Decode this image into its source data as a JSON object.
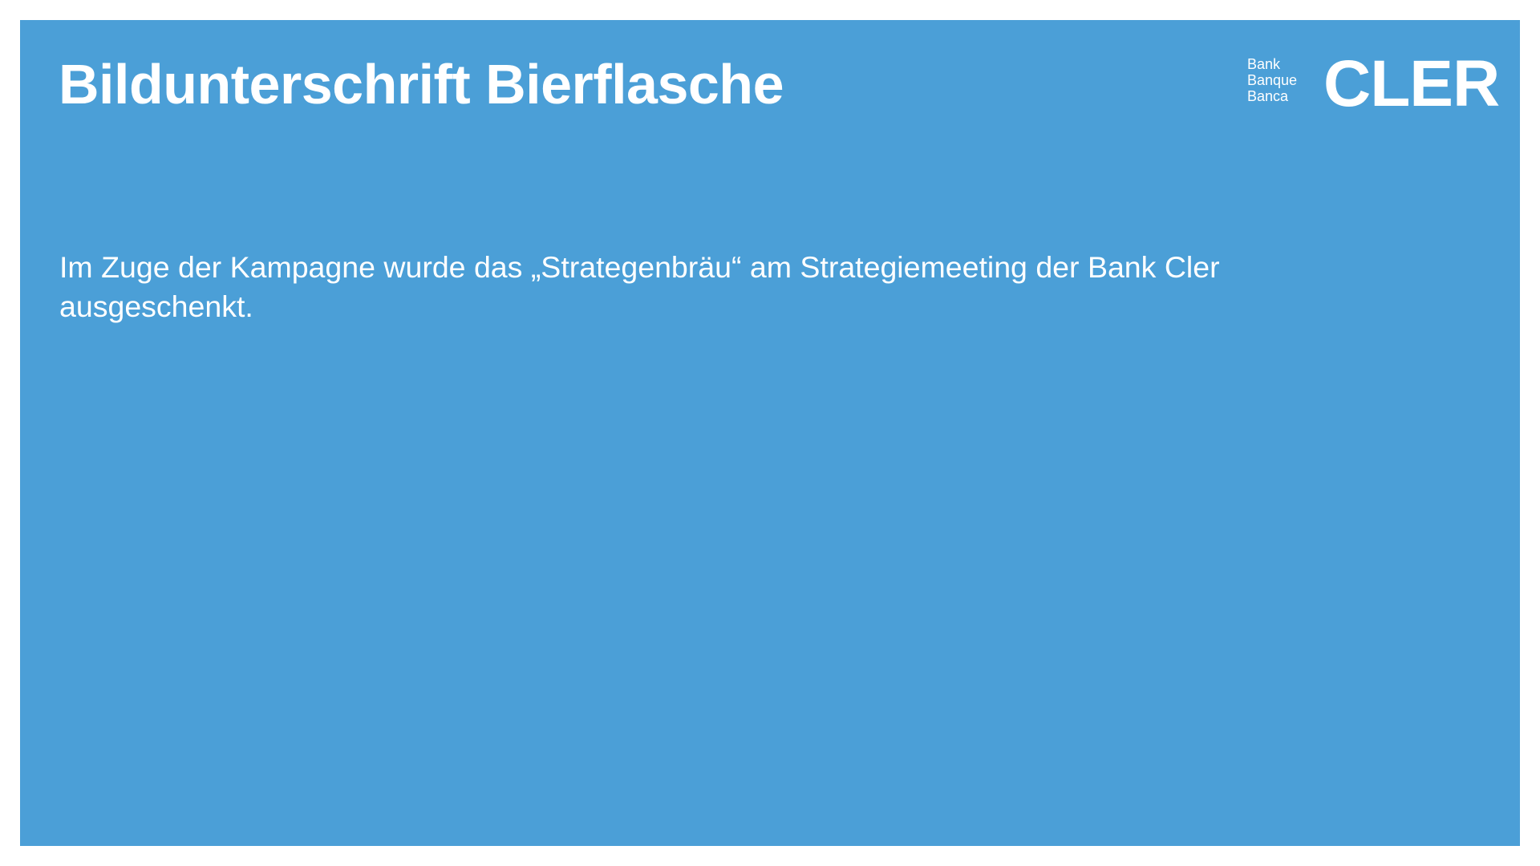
{
  "slide": {
    "title": "Bildunterschrift Bierflasche",
    "body": "Im Zuge der Kampagne wurde das „Strategenbräu“ am Strategiemeeting der Bank Cler ausgeschenkt."
  },
  "logo": {
    "lines": [
      "Bank",
      "Banque",
      "Banca"
    ],
    "name": "CLER"
  },
  "colors": {
    "background": "#4b9fd7",
    "text": "#ffffff",
    "frame": "#ffffff"
  }
}
